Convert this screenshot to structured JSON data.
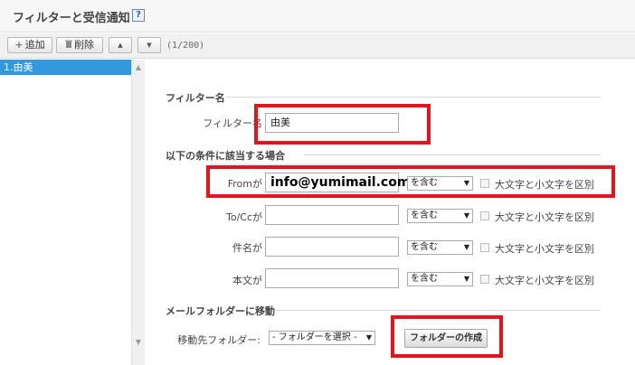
{
  "header": {
    "title": "フィルターと受信通知",
    "help": "?"
  },
  "toolbar": {
    "add_icon": "+",
    "add_label": "追加",
    "delete_label": "削除",
    "up_arrow": "▲",
    "down_arrow": "▼",
    "count": "(1/200)"
  },
  "filter_list": {
    "items": [
      {
        "label": "1.由美"
      }
    ]
  },
  "scrollbar": {
    "up": "▲",
    "down": "▼"
  },
  "sections": {
    "filter_name": {
      "heading": "フィルター名",
      "label": "フィルター名",
      "value": "由美"
    },
    "conditions": {
      "heading": "以下の条件に該当する場合",
      "rows": [
        {
          "label": "Fromが",
          "value": "info@yumimail.com",
          "match": "を含む",
          "case_label": "大文字と小文字を区別"
        },
        {
          "label": "To/Ccが",
          "value": "",
          "match": "を含む",
          "case_label": "大文字と小文字を区別"
        },
        {
          "label": "件名が",
          "value": "",
          "match": "を含む",
          "case_label": "大文字と小文字を区別"
        },
        {
          "label": "本文が",
          "value": "",
          "match": "を含む",
          "case_label": "大文字と小文字を区別"
        }
      ]
    },
    "move": {
      "heading": "メールフォルダーに移動",
      "folder_label": "移動先フォルダー:",
      "folder_select": "- フォルダーを選択 -",
      "create_button": "フォルダーの作成"
    }
  },
  "colors": {
    "highlight_red": "#e3141e",
    "selected_item": "#3399dd"
  },
  "icons": {
    "add": "plus-icon",
    "delete": "trash-icon",
    "help": "help-icon"
  }
}
